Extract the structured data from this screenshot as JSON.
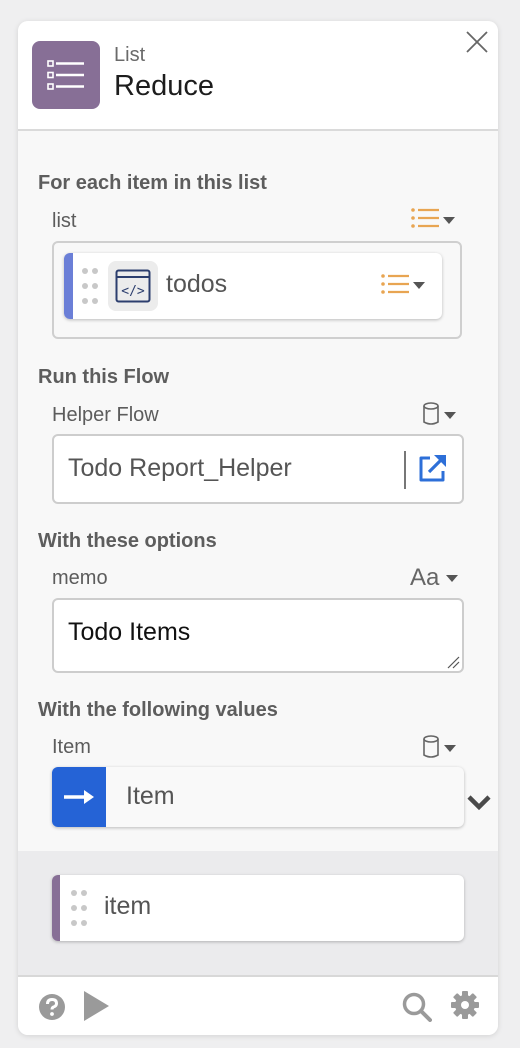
{
  "header": {
    "category": "List",
    "title": "Reduce",
    "icon": "list-icon",
    "icon_color": "#876f96"
  },
  "sections": {
    "list_section": {
      "title": "For each item in this list",
      "field_label": "list",
      "type_icon": "list-type-icon",
      "chip": {
        "label": "todos",
        "icon": "code-window-icon",
        "bar_color": "#6b7fd7",
        "type_icon": "list-type-icon"
      }
    },
    "flow_section": {
      "title": "Run this Flow",
      "field_label": "Helper Flow",
      "type_icon": "database-icon",
      "value": "Todo Report_Helper",
      "open_icon": "external-link-icon"
    },
    "options_section": {
      "title": "With these options",
      "field_label": "memo",
      "type_label": "Aa",
      "value": "Todo Items"
    },
    "values_section": {
      "title": "With the following values",
      "field_label": "Item",
      "type_icon": "database-icon",
      "mapping": {
        "label": "Item",
        "icon": "arrow-right-icon",
        "accent": "#2563d6"
      },
      "expand_icon": "chevron-down-icon"
    }
  },
  "output_chip": {
    "label": "item",
    "bar_color": "#876f96"
  },
  "footer": {
    "left_icons": [
      "help-icon",
      "play-icon"
    ],
    "right_icons": [
      "search-icon",
      "gear-icon"
    ]
  },
  "colors": {
    "list_type": "#e8a552",
    "link_blue": "#2d6fd8"
  }
}
